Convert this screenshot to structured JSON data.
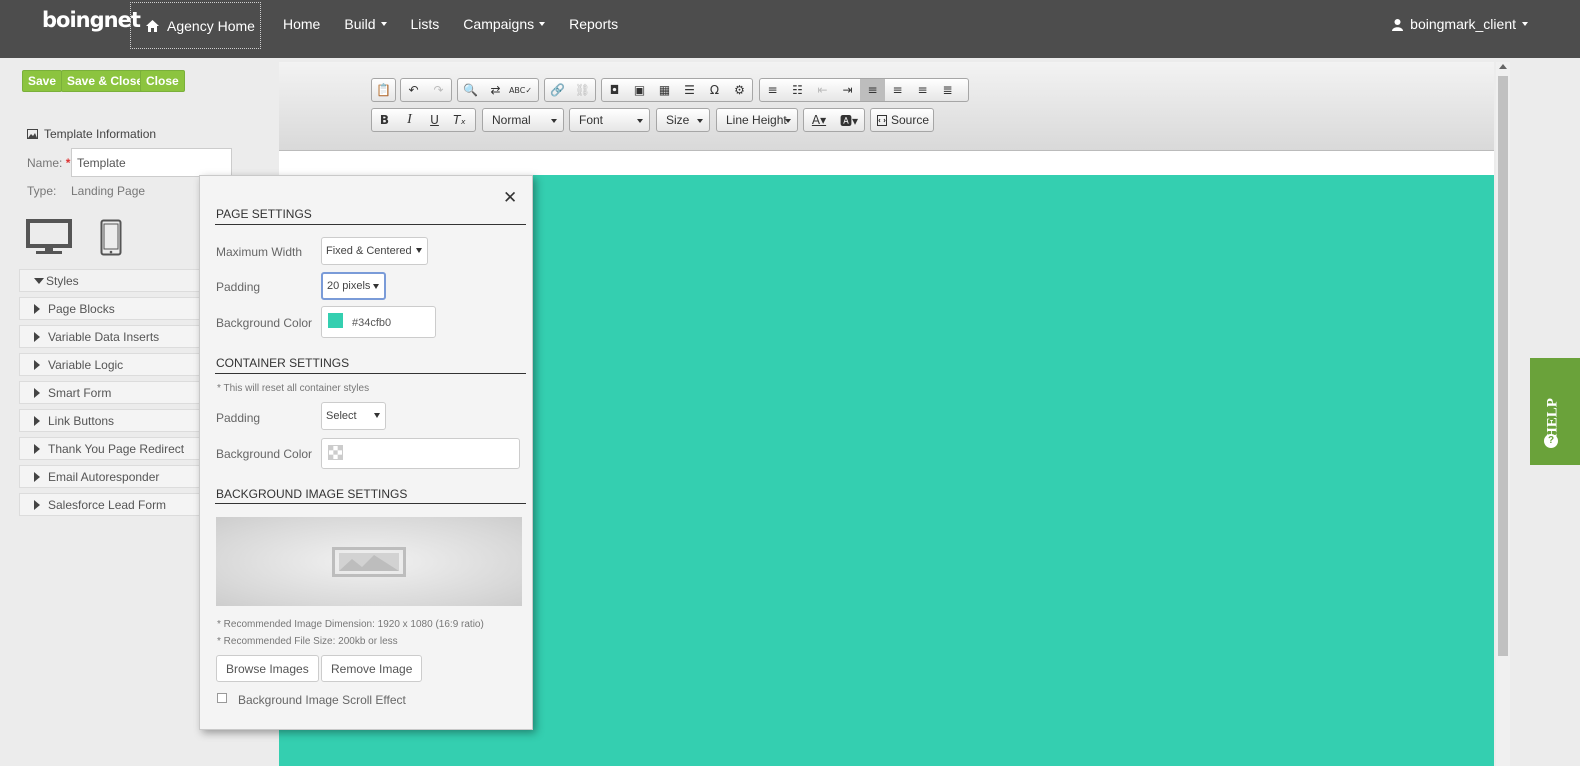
{
  "nav": {
    "logo": "boingnet",
    "agency_home": "Agency Home",
    "links": [
      "Home",
      "Build",
      "Lists",
      "Campaigns",
      "Reports"
    ],
    "user": "boingmark_client"
  },
  "actions": {
    "save": "Save",
    "save_close": "Save & Close",
    "close": "Close"
  },
  "template": {
    "heading": "Template Information",
    "name_label": "Name:",
    "name_value": "Template",
    "type_label": "Type:",
    "type_value": "Landing Page"
  },
  "sidebar": {
    "items": [
      "Styles",
      "Page Blocks",
      "Variable Data Inserts",
      "Variable Logic",
      "Smart Form",
      "Link Buttons",
      "Thank You Page Redirect",
      "Email Autoresponder",
      "Salesforce Lead Form"
    ]
  },
  "toolbar": {
    "format": "Normal",
    "font": "Font",
    "size": "Size",
    "line_height": "Line Height",
    "source": "Source"
  },
  "popup": {
    "page_settings": "PAGE SETTINGS",
    "max_width_label": "Maximum Width",
    "max_width_value": "Fixed & Centered",
    "padding_label": "Padding",
    "padding_value": "20 pixels",
    "bg_color_label": "Background Color",
    "bg_color_value": "#34cfb0",
    "container_settings": "CONTAINER SETTINGS",
    "container_note": "* This will reset all container styles",
    "container_padding_label": "Padding",
    "container_padding_value": "Select",
    "container_bg_label": "Background Color",
    "bg_image_settings": "BACKGROUND IMAGE SETTINGS",
    "rec_dimension": "* Recommended Image Dimension: 1920 x 1080 (16:9 ratio)",
    "rec_size": "* Recommended File Size: 200kb or less",
    "browse": "Browse Images",
    "remove": "Remove Image",
    "scroll_effect": "Background Image Scroll Effect"
  },
  "help": "HELP",
  "colors": {
    "canvas": "#34cfb0",
    "accent_green": "#8cc43f",
    "nav_bg": "#4d4d4d",
    "help_bg": "#6aa23a"
  }
}
